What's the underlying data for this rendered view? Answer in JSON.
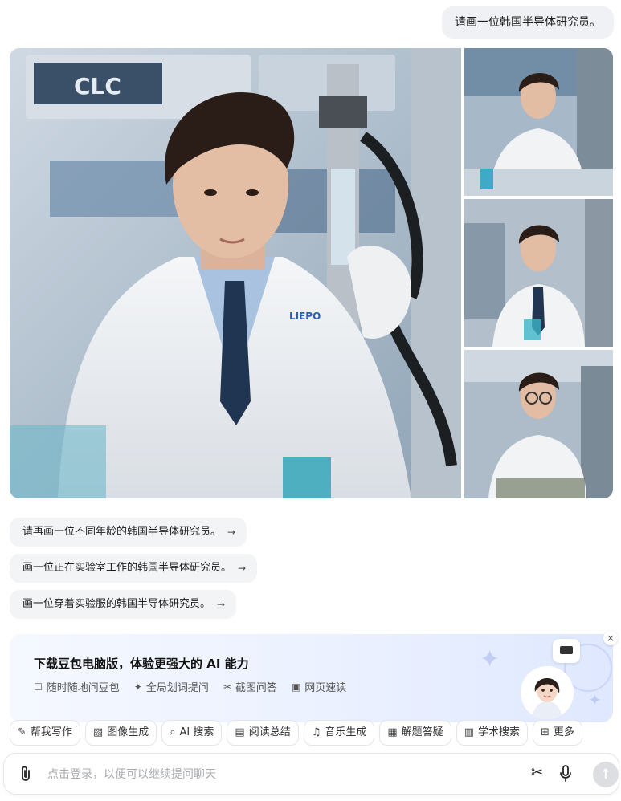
{
  "chat": {
    "user_message": "请画一位韩国半导体研究员。"
  },
  "images": {
    "main_alt": "Korean semiconductor researcher in lab coat",
    "main_badge": "CLC",
    "main_coat_logo": "LIEPO"
  },
  "suggestions": [
    {
      "label": "请再画一位不同年龄的韩国半导体研究员。",
      "arrow": "→"
    },
    {
      "label": "画一位正在实验室工作的韩国半导体研究员。",
      "arrow": "→"
    },
    {
      "label": "画一位穿着实验服的韩国半导体研究员。",
      "arrow": "→"
    }
  ],
  "promo": {
    "title": "下载豆包电脑版，体验更强大的 AI 能力",
    "features": [
      {
        "icon": "chat-bubble-icon",
        "glyph": "☐",
        "label": "随时随地问豆包"
      },
      {
        "icon": "sparkle-icon",
        "glyph": "✦",
        "label": "全局划词提问"
      },
      {
        "icon": "scissors-icon",
        "glyph": "✂",
        "label": "截图问答"
      },
      {
        "icon": "web-read-icon",
        "glyph": "▣",
        "label": "网页速读"
      }
    ],
    "close": "×"
  },
  "toolbar": [
    {
      "icon": "pen-icon",
      "glyph": "✎",
      "label": "帮我写作"
    },
    {
      "icon": "image-icon",
      "glyph": "▨",
      "label": "图像生成"
    },
    {
      "icon": "search-icon",
      "glyph": "⌕",
      "label": "AI 搜索"
    },
    {
      "icon": "read-icon",
      "glyph": "▤",
      "label": "阅读总结"
    },
    {
      "icon": "music-icon",
      "glyph": "♫",
      "label": "音乐生成"
    },
    {
      "icon": "solve-icon",
      "glyph": "▦",
      "label": "解题答疑"
    },
    {
      "icon": "academic-icon",
      "glyph": "▥",
      "label": "学术搜索"
    },
    {
      "icon": "more-icon",
      "glyph": "⊞",
      "label": "更多"
    }
  ],
  "input": {
    "placeholder": "点击登录，以便可以继续提问聊天",
    "send": "↑"
  },
  "colors": {
    "bubble_bg": "#eff1f4",
    "promo_bg": "#eaf0ff",
    "send_bg": "#dcdee2"
  }
}
